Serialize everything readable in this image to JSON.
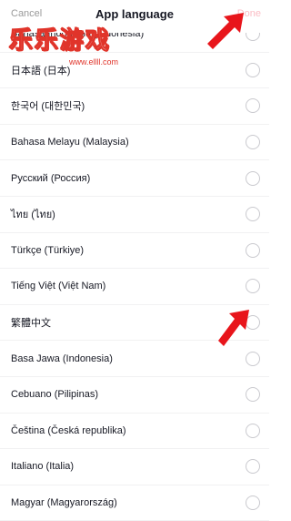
{
  "header": {
    "cancel_label": "Cancel",
    "title": "App language",
    "done_label": "Done"
  },
  "watermark": {
    "title": "乐乐游戏",
    "site": "www.ellll.com"
  },
  "languages": [
    {
      "label": "Bahasa Indonesia (Indonesia)"
    },
    {
      "label": "日本語 (日本)"
    },
    {
      "label": "한국어 (대한민국)"
    },
    {
      "label": "Bahasa Melayu (Malaysia)"
    },
    {
      "label": "Русский (Россия)"
    },
    {
      "label": "ไทย (ไทย)"
    },
    {
      "label": "Türkçe (Türkiye)"
    },
    {
      "label": "Tiếng Việt (Việt Nam)"
    },
    {
      "label": "繁體中文"
    },
    {
      "label": "Basa Jawa (Indonesia)"
    },
    {
      "label": "Cebuano (Pilipinas)"
    },
    {
      "label": "Čeština (Česká republika)"
    },
    {
      "label": "Italiano (Italia)"
    },
    {
      "label": "Magyar (Magyarország)"
    }
  ],
  "colors": {
    "done_disabled": "#fbbcc4",
    "annotation_arrow": "#e8151b",
    "radio_border": "#c9c9ce",
    "divider": "#f1f1f2"
  },
  "icons": {
    "annotation": "red-arrow-icon",
    "radio": "radio-circle-icon"
  }
}
